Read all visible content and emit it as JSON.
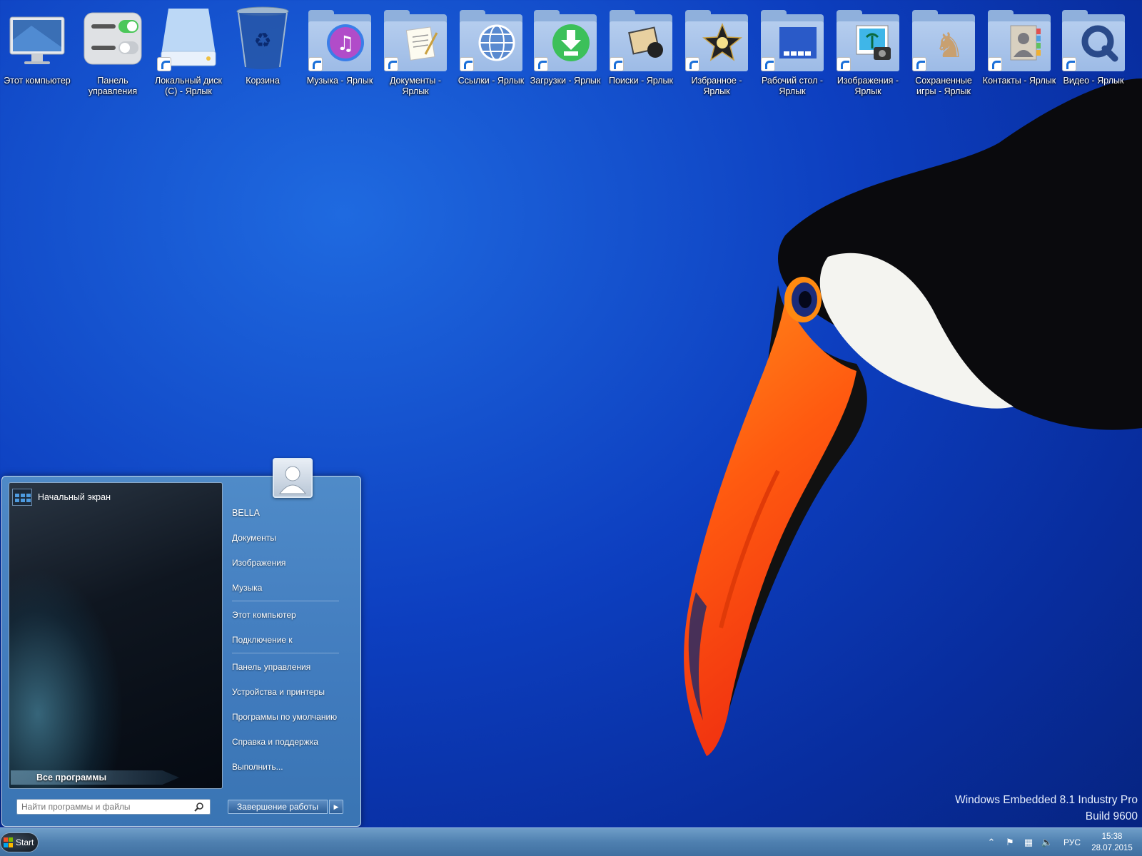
{
  "desktop": {
    "icons": [
      {
        "label": "Этот компьютер",
        "icon": "monitor-icon"
      },
      {
        "label": "Панель управления",
        "icon": "control-panel-icon"
      },
      {
        "label": "Локальный диск (C) - Ярлык",
        "icon": "drive-icon"
      },
      {
        "label": "Корзина",
        "icon": "recycle-bin-icon"
      },
      {
        "label": "Музыка - Ярлык",
        "icon": "music-folder-icon"
      },
      {
        "label": "Документы - Ярлык",
        "icon": "documents-folder-icon"
      },
      {
        "label": "Ссылки - Ярлык",
        "icon": "links-folder-icon"
      },
      {
        "label": "Загрузки - Ярлык",
        "icon": "downloads-folder-icon"
      },
      {
        "label": "Поиски - Ярлык",
        "icon": "searches-folder-icon"
      },
      {
        "label": "Избранное - Ярлык",
        "icon": "favorites-folder-icon"
      },
      {
        "label": "Рабочий стол - Ярлык",
        "icon": "desktop-folder-icon"
      },
      {
        "label": "Изображения - Ярлык",
        "icon": "pictures-folder-icon"
      },
      {
        "label": "Сохраненные игры - Ярлык",
        "icon": "saved-games-folder-icon"
      },
      {
        "label": "Контакты - Ярлык",
        "icon": "contacts-folder-icon"
      },
      {
        "label": "Видео - Ярлык",
        "icon": "videos-folder-icon"
      }
    ]
  },
  "watermark": {
    "line1": "Windows Embedded 8.1 Industry Pro",
    "line2": "Build 9600"
  },
  "start_menu": {
    "start_screen_label": "Начальный экран",
    "all_programs_label": "Все программы",
    "search_placeholder": "Найти программы и файлы",
    "user_name": "BELLA",
    "right_items": [
      "Документы",
      "Изображения",
      "Музыка",
      "Этот компьютер",
      "Подключение к",
      "Панель управления",
      "Устройства и принтеры",
      "Программы по умолчанию",
      "Справка и поддержка",
      "Выполнить..."
    ],
    "shutdown_label": "Завершение работы"
  },
  "taskbar": {
    "start_label": "Start",
    "language": "РУС",
    "time": "15:38",
    "date": "28.07.2015"
  },
  "colors": {
    "desktop_blue": "#0d3fc0",
    "taskbar": "#4f80b0",
    "folder": "#9dbbe6"
  }
}
